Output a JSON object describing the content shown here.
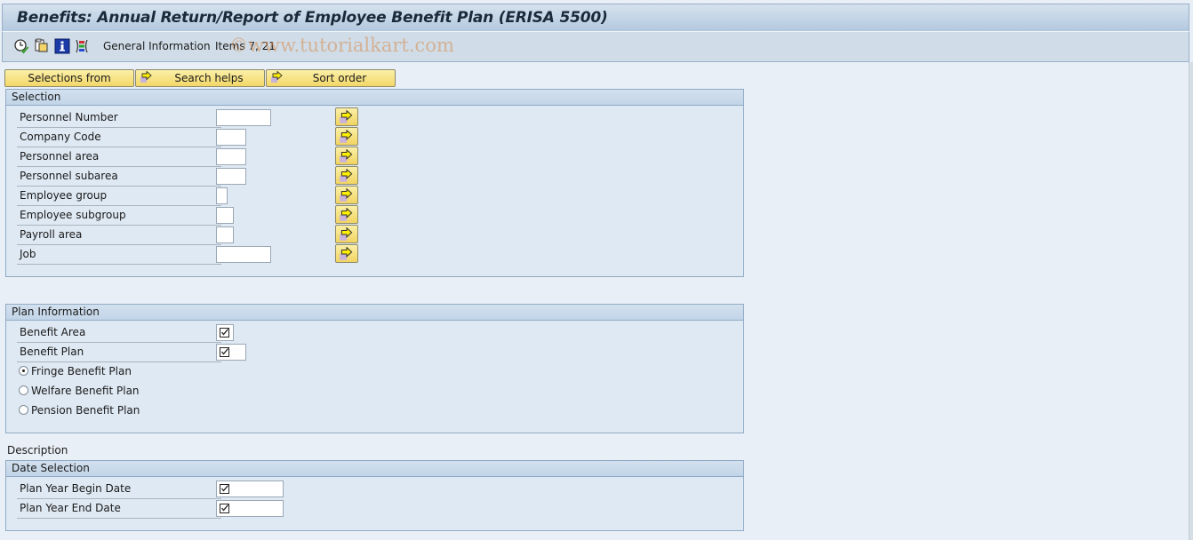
{
  "window": {
    "title": "Benefits: Annual Return/Report of Employee Benefit Plan (ERISA 5500)"
  },
  "toolbar": {
    "icons": [
      {
        "name": "execute-icon",
        "label": "Execute"
      },
      {
        "name": "copy-variant-icon",
        "label": "Get Variant"
      },
      {
        "name": "info-icon",
        "label": "Program Documentation"
      },
      {
        "name": "dynamic-selections-icon",
        "label": "Dynamic Selections"
      }
    ],
    "general_information": "General Information",
    "items": "Items 7, 21",
    "watermark": "©www.tutorialkart.com"
  },
  "buttons": {
    "selections_from": "Selections from",
    "search_helps": "Search helps",
    "sort_order": "Sort order"
  },
  "selection": {
    "title": "Selection",
    "fields": [
      {
        "label": "Personnel Number",
        "value": ""
      },
      {
        "label": "Company Code",
        "value": ""
      },
      {
        "label": "Personnel area",
        "value": ""
      },
      {
        "label": "Personnel subarea",
        "value": ""
      },
      {
        "label": "Employee group",
        "value": ""
      },
      {
        "label": "Employee subgroup",
        "value": ""
      },
      {
        "label": "Payroll area",
        "value": ""
      },
      {
        "label": "Job",
        "value": ""
      }
    ]
  },
  "plan_information": {
    "title": "Plan Information",
    "fields": [
      {
        "label": "Benefit Area",
        "value": "",
        "required": true
      },
      {
        "label": "Benefit Plan",
        "value": "",
        "required": true
      }
    ],
    "radios": [
      {
        "label": "Fringe Benefit Plan",
        "selected": true
      },
      {
        "label": "Welfare Benefit Plan",
        "selected": false
      },
      {
        "label": "Pension Benefit Plan",
        "selected": false
      }
    ]
  },
  "description_label": "Description",
  "date_selection": {
    "title": "Date Selection",
    "fields": [
      {
        "label": "Plan Year Begin Date",
        "value": "",
        "required": true
      },
      {
        "label": "Plan Year End Date",
        "value": "",
        "required": true
      }
    ]
  }
}
